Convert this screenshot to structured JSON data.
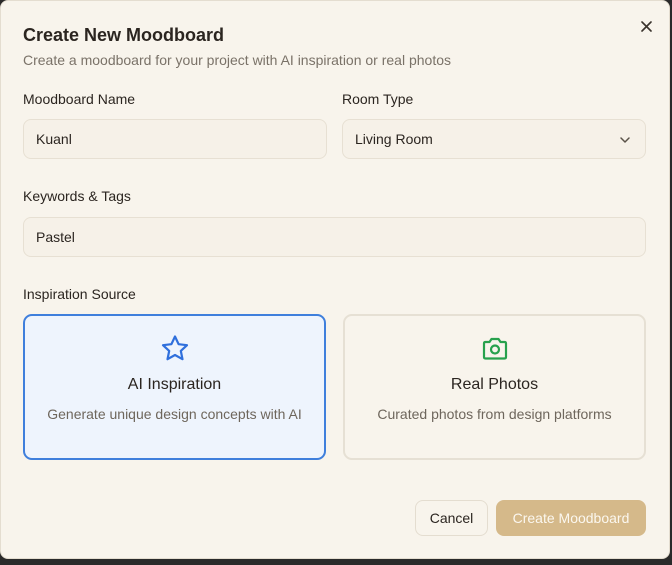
{
  "dialog": {
    "title": "Create New Moodboard",
    "subtitle": "Create a moodboard for your project with AI inspiration or real photos"
  },
  "form": {
    "name_label": "Moodboard Name",
    "name_value": "Kuanl",
    "room_label": "Room Type",
    "room_value": "Living Room",
    "keywords_label": "Keywords & Tags",
    "keywords_value": "Pastel",
    "source_label": "Inspiration Source"
  },
  "sources": [
    {
      "title": "AI Inspiration",
      "description": "Generate unique design concepts with AI",
      "icon": "star-icon",
      "selected": true
    },
    {
      "title": "Real Photos",
      "description": "Curated photos from design platforms",
      "icon": "camera-icon",
      "selected": false
    }
  ],
  "buttons": {
    "cancel": "Cancel",
    "create": "Create Moodboard"
  },
  "colors": {
    "background": "#f8f4ec",
    "selected_border": "#3f7fdc",
    "selected_fill": "#eef4fd",
    "star_icon": "#2f6fdc",
    "camera_icon": "#27a14d",
    "primary_button": "#d5b98a"
  }
}
